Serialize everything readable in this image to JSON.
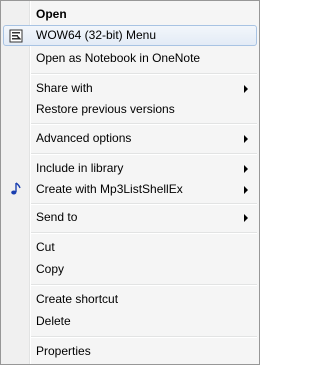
{
  "menu": {
    "items": [
      {
        "label": "Open"
      },
      {
        "label": "WOW64 (32-bit) Menu",
        "icon": "wow64-icon"
      },
      {
        "label": "Open as Notebook in OneNote"
      },
      {
        "label": "Share with"
      },
      {
        "label": "Restore previous versions"
      },
      {
        "label": "Advanced options"
      },
      {
        "label": "Include in library"
      },
      {
        "label": "Create with Mp3ListShellEx",
        "icon": "music-note-icon"
      },
      {
        "label": "Send to"
      },
      {
        "label": "Cut"
      },
      {
        "label": "Copy"
      },
      {
        "label": "Create shortcut"
      },
      {
        "label": "Delete"
      },
      {
        "label": "Properties"
      }
    ]
  },
  "colors": {
    "menu_border": "#979797",
    "hover_border": "#a8c3e3",
    "note_icon": "#1a3fb0"
  }
}
